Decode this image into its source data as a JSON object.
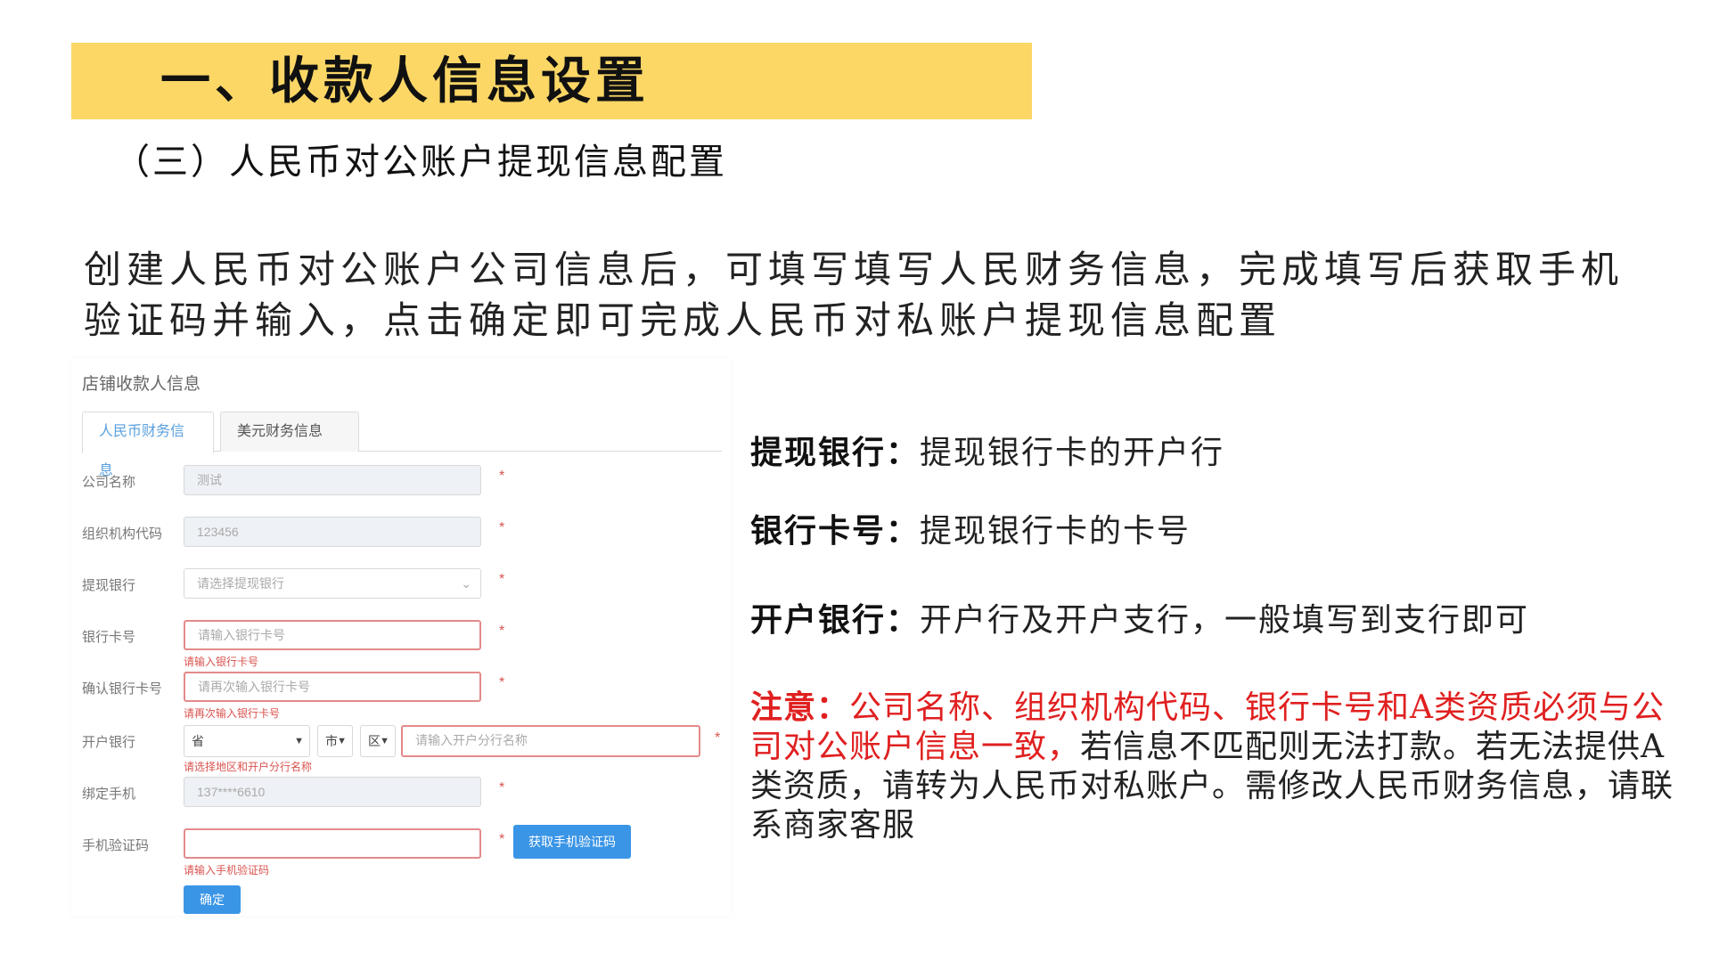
{
  "banner": {
    "title": "一、收款人信息设置"
  },
  "subtitle": "（三）人民币对公账户提现信息配置",
  "intro": {
    "line1": "创建人民币对公账户公司信息后，可填写填写人民财务信息，完成填写后获取手机",
    "line2": "验证码并输入，点击确定即可完成人民币对私账户提现信息配置"
  },
  "colors": {
    "banner": "#fcd766",
    "accent": "#3a95e6",
    "error": "#d9534f",
    "notice": "#e02020"
  },
  "form": {
    "title": "店铺收款人信息",
    "tabs": [
      {
        "label": "人民币财务信息",
        "active": true
      },
      {
        "label": "美元财务信息",
        "active": false
      }
    ],
    "required_mark": "*",
    "fields": {
      "company": {
        "label": "公司名称",
        "value": "测试"
      },
      "org_code": {
        "label": "组织机构代码",
        "value": "123456"
      },
      "bank": {
        "label": "提现银行",
        "placeholder": "请选择提现银行",
        "icon": "chevron-down-icon"
      },
      "card": {
        "label": "银行卡号",
        "placeholder": "请输入银行卡号",
        "error": "请输入银行卡号"
      },
      "confirm_card": {
        "label": "确认银行卡号",
        "placeholder": "请再次输入银行卡号",
        "error": "请再次输入银行卡号"
      },
      "branch": {
        "label": "开户银行",
        "province": "省",
        "city": "市",
        "district": "区",
        "placeholder": "请输入开户分行名称",
        "error": "请选择地区和开户分行名称"
      },
      "phone": {
        "label": "绑定手机",
        "value": "137****6610"
      },
      "sms": {
        "label": "手机验证码",
        "error": "请输入手机验证码"
      }
    },
    "get_code_button": "获取手机验证码",
    "ok_button": "确定"
  },
  "notes": {
    "bank": {
      "term": "提现银行：",
      "desc": "提现银行卡的开户行"
    },
    "card": {
      "term": "银行卡号：",
      "desc": "提现银行卡的卡号"
    },
    "branch": {
      "term": "开户银行：",
      "desc": "开户行及开户支行，一般填写到支行即可"
    },
    "notice": {
      "label": "注意：",
      "red_text": "公司名称、组织机构代码、银行卡号和A类资质必须与公司对公账户信息一致，",
      "black_text": "若信息不匹配则无法打款。若无法提供A类资质，请转为人民币对私账户。需修改人民币财务信息，请联系商家客服"
    }
  }
}
